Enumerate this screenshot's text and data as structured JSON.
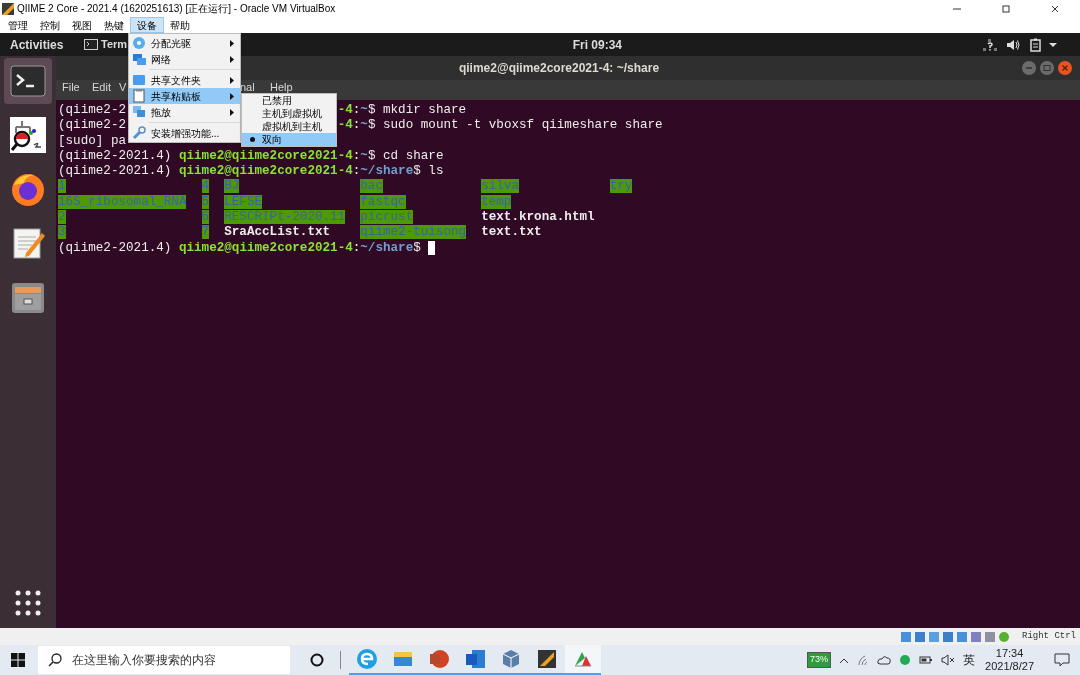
{
  "window": {
    "title": "QIIME 2 Core - 2021.4 (1620251613) [正在运行] - Oracle VM VirtualBox"
  },
  "menubar": [
    {
      "label": "管理",
      "selected": false
    },
    {
      "label": "控制",
      "selected": false
    },
    {
      "label": "视图",
      "selected": false
    },
    {
      "label": "热键",
      "selected": false
    },
    {
      "label": "设备",
      "selected": true
    },
    {
      "label": "帮助",
      "selected": false
    }
  ],
  "devices_menu": [
    {
      "kind": "item",
      "label": "分配光驱",
      "submenu": true,
      "selected": false
    },
    {
      "kind": "item",
      "label": "网络",
      "submenu": true,
      "selected": false
    },
    {
      "kind": "separator"
    },
    {
      "kind": "item",
      "label": "共享文件夹",
      "submenu": true,
      "selected": false
    },
    {
      "kind": "item",
      "label": "共享粘贴板",
      "submenu": true,
      "selected": true
    },
    {
      "kind": "item",
      "label": "拖放",
      "submenu": true,
      "selected": false
    },
    {
      "kind": "separator"
    },
    {
      "kind": "item",
      "label": "安装增强功能...",
      "submenu": false,
      "selected": false
    }
  ],
  "clipboard_submenu": [
    {
      "label": "已禁用",
      "checked": false,
      "selected": false
    },
    {
      "label": "主机到虚拟机",
      "checked": false,
      "selected": false
    },
    {
      "label": "虚拟机到主机",
      "checked": false,
      "selected": false
    },
    {
      "label": "双向",
      "checked": true,
      "selected": true
    }
  ],
  "top_bar": {
    "activities": "Activities",
    "app": "Term",
    "clock": "Fri 09:34"
  },
  "dock": [
    {
      "selected": true
    },
    {
      "selected": false
    },
    {
      "selected": false
    },
    {
      "selected": false
    },
    {
      "selected": false
    }
  ],
  "terminal": {
    "title": "qiime2@qiime2core2021-4: ~/share",
    "menu": [
      "File",
      "Edit",
      "V",
      "nal",
      "Help"
    ],
    "lines": [
      {
        "before": [
          {
            "kind": "plain",
            "text": "(qiime2-2"
          }
        ],
        "after": [
          {
            "kind": "user",
            "text": "-4"
          },
          {
            "kind": "plain",
            "text": ":"
          },
          {
            "kind": "path",
            "text": "~"
          },
          {
            "kind": "plain",
            "text": "$ mkdir share"
          }
        ]
      },
      {
        "before": [
          {
            "kind": "plain",
            "text": "(qiime2-2"
          }
        ],
        "after": [
          {
            "kind": "user",
            "text": "-4"
          },
          {
            "kind": "plain",
            "text": ":"
          },
          {
            "kind": "path",
            "text": "~"
          },
          {
            "kind": "plain",
            "text": "$ sudo mount -t vboxsf qiimeshare share"
          }
        ]
      },
      {
        "before": [
          {
            "kind": "plain",
            "text": "[sudo] pa"
          }
        ]
      },
      {
        "full": [
          {
            "kind": "plain",
            "text": "(qiime2-2021.4) "
          },
          {
            "kind": "user",
            "text": "qiime2@qiime2core2021-4"
          },
          {
            "kind": "plain",
            "text": ":"
          },
          {
            "kind": "path",
            "text": "~"
          },
          {
            "kind": "plain",
            "text": "$ cd share"
          }
        ]
      },
      {
        "full": [
          {
            "kind": "plain",
            "text": "(qiime2-2021.4) "
          },
          {
            "kind": "user",
            "text": "qiime2@qiime2core2021-4"
          },
          {
            "kind": "plain",
            "text": ":"
          },
          {
            "kind": "path",
            "text": "~/share"
          },
          {
            "kind": "plain",
            "text": "$ ls"
          }
        ]
      }
    ],
    "ls_rows": [
      [
        {
          "name": "1",
          "kind": "dir"
        },
        {
          "name": "4",
          "kind": "dir"
        },
        {
          "name": "BJ",
          "kind": "dir"
        },
        {
          "name": "bac",
          "kind": "dir"
        },
        {
          "name": "silva",
          "kind": "dir"
        },
        {
          "name": "try",
          "kind": "dir"
        }
      ],
      [
        {
          "name": "16S_ribosomal_RNA",
          "kind": "dir"
        },
        {
          "name": "5",
          "kind": "dir"
        },
        {
          "name": "LEFSE",
          "kind": "dir"
        },
        {
          "name": "fastqc",
          "kind": "dir"
        },
        {
          "name": "temp",
          "kind": "dir"
        }
      ],
      [
        {
          "name": "2",
          "kind": "dir"
        },
        {
          "name": "6",
          "kind": "dir"
        },
        {
          "name": "RESCRIPt-2020.11",
          "kind": "dir"
        },
        {
          "name": "picrust",
          "kind": "dir"
        },
        {
          "name": "text.krona.html",
          "kind": "file"
        }
      ],
      [
        {
          "name": "3",
          "kind": "dir"
        },
        {
          "name": "7",
          "kind": "dir"
        },
        {
          "name": "SraAccList.txt",
          "kind": "file"
        },
        {
          "name": "qiime2-tuisong",
          "kind": "dir"
        },
        {
          "name": "text.txt",
          "kind": "file"
        }
      ]
    ],
    "prompt": [
      {
        "kind": "plain",
        "text": "(qiime2-2021.4) "
      },
      {
        "kind": "user",
        "text": "qiime2@qiime2core2021-4"
      },
      {
        "kind": "plain",
        "text": ":"
      },
      {
        "kind": "path",
        "text": "~/share"
      },
      {
        "kind": "plain",
        "text": "$"
      }
    ]
  },
  "status_bar": {
    "host_key": "Right Ctrl"
  },
  "taskbar": {
    "search_placeholder": "在这里输入你要搜索的内容",
    "apps": [
      {
        "selected": false
      },
      {
        "selected": false
      },
      {
        "selected": false
      },
      {
        "selected": false
      },
      {
        "selected": false
      },
      {
        "selected": false
      },
      {
        "selected": true
      }
    ],
    "battery": "73%",
    "ime": "英",
    "time": "17:34",
    "date": "2021/8/27"
  }
}
